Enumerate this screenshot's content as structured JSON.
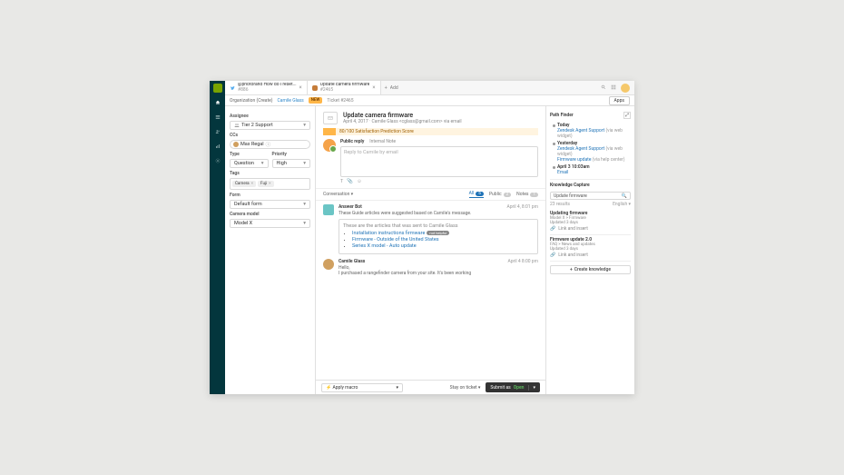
{
  "tabs": [
    {
      "title_line1": "@photorand How do I reset...",
      "title_line2": "#886"
    },
    {
      "title_line1": "Update camera firmware",
      "title_line2": "#2465"
    }
  ],
  "add_placeholder": "Add",
  "crumbs": {
    "org": "Organization (Create)",
    "user": "Camile Glass",
    "new": "NEW",
    "ticket": "Ticket #2465"
  },
  "apps_btn": "Apps",
  "left": {
    "assignee_label": "Assignee",
    "assignee_value": "Tier 2 Support",
    "ccs_label": "CCs",
    "cc_name": "Max Regal",
    "type_label": "Type",
    "type_value": "Question",
    "priority_label": "Priority",
    "priority_value": "High",
    "tags_label": "Tags",
    "tags": [
      "Camera",
      "Fuji"
    ],
    "form_label": "Form",
    "form_value": "Default form",
    "model_label": "Camera model",
    "model_value": "Model X"
  },
  "ticket": {
    "title": "Update camera firmware",
    "subtitle": "April 4, 2017 · Camile Glass <cglass@gmail.com> via email",
    "score": "80/100 Satisfaction Prediction Score",
    "reply_tab": "Public reply",
    "note_tab": "Internal Note",
    "reply_placeholder": "Reply to Camile by email"
  },
  "conv": {
    "label": "Conversation",
    "all": "All",
    "all_n": "6",
    "public": "Public",
    "public_n": "2",
    "notes": "Notes",
    "notes_n": "1"
  },
  "bot": {
    "name": "Answer Bot",
    "time": "April 4, 8:01 pm",
    "summary": "These Guide articles were suggested based on Camile's message.",
    "heading": "These are the articles that was sent to Camile Glass",
    "links": [
      "Installation instructions firmware",
      "Firmware - Outside of the United States",
      "Series X model - Auto update"
    ],
    "nothelpful": "not helpful"
  },
  "msg": {
    "name": "Camile Glass",
    "time": "April 4 8:00 pm",
    "l1": "Hello,",
    "l2": "I purchased a rangefinder camera from your site. It's been working"
  },
  "footer": {
    "macro": "Apply macro",
    "stay": "Stay on ticket",
    "submit_as": "Submit as",
    "status": "Open"
  },
  "pathfinder": {
    "title": "Path Finder",
    "items": [
      {
        "h": "Today",
        "lines": [
          {
            "t": "Zendesk Agent Support",
            "s": "(via web widget)"
          }
        ]
      },
      {
        "h": "Yesterday",
        "lines": [
          {
            "t": "Zendesk Agent Support",
            "s": "(via web widget)"
          },
          {
            "t": "Firmware update",
            "s": "(via help center)"
          }
        ]
      },
      {
        "h": "April 3 10:03am",
        "lines": [
          {
            "t": "Email",
            "s": ""
          }
        ]
      }
    ]
  },
  "kc": {
    "title": "Knowledge Capture",
    "search": "Update firmware",
    "results": "23 results",
    "lang": "English",
    "cards": [
      {
        "t": "Updating firmware",
        "b": "Model X > Firmware",
        "u": "Updated 3 days",
        "a": "Link and insert"
      },
      {
        "t": "Firmware update 2.0",
        "b": "FAQ > News and updates",
        "u": "Updated 3 days",
        "a": "Link and insert"
      }
    ],
    "create": "Create knowledge"
  }
}
